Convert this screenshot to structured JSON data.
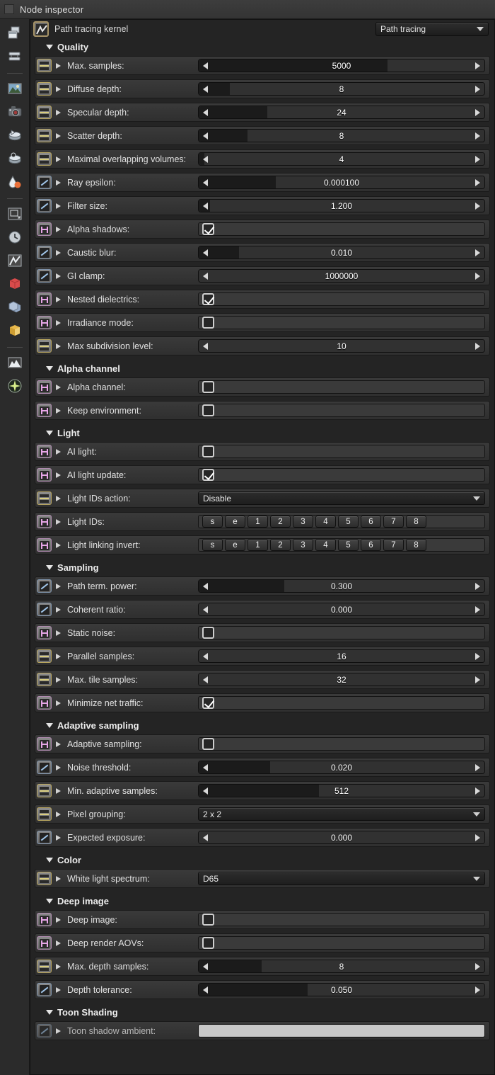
{
  "window": {
    "title": "Node inspector"
  },
  "header": {
    "node_name": "Path tracing kernel",
    "kernel_select": "Path tracing",
    "node_icon": "path-tracing-kernel-icon",
    "caret_icon": "chevron-down-icon"
  },
  "rail": {
    "items": [
      {
        "name": "copy-nodes-icon",
        "glyph": "windows"
      },
      {
        "name": "stack-nodes-icon",
        "glyph": "stack"
      },
      {
        "sep": true
      },
      {
        "name": "image-preview-icon",
        "glyph": "image"
      },
      {
        "name": "camera-icon",
        "glyph": "camera"
      },
      {
        "name": "film-reel-icon",
        "glyph": "reel1"
      },
      {
        "name": "film-reel-alt-icon",
        "glyph": "reel2"
      },
      {
        "name": "color-drop-icon",
        "glyph": "drop"
      },
      {
        "sep": true
      },
      {
        "name": "resolution-icon",
        "glyph": "frame"
      },
      {
        "name": "clock-icon",
        "glyph": "clock"
      },
      {
        "name": "kernel-icon",
        "glyph": "kernel"
      },
      {
        "name": "red-cube-icon",
        "glyph": "cubeRed"
      },
      {
        "name": "blue-layers-icon",
        "glyph": "cubeBlue"
      },
      {
        "name": "orange-geometry-icon",
        "glyph": "cubeOrange"
      },
      {
        "sep": true
      },
      {
        "name": "histogram-icon",
        "glyph": "histogram"
      },
      {
        "name": "light-star-icon",
        "glyph": "star"
      }
    ]
  },
  "sections": [
    {
      "title": "Quality",
      "rows": [
        {
          "type": "slider",
          "icon": "int",
          "label": "Max. samples:",
          "value": "5000",
          "fill": 66
        },
        {
          "type": "slider",
          "icon": "int",
          "label": "Diffuse depth:",
          "value": "8",
          "fill": 11
        },
        {
          "type": "slider",
          "icon": "int",
          "label": "Specular depth:",
          "value": "24",
          "fill": 24
        },
        {
          "type": "slider",
          "icon": "int",
          "label": "Scatter depth:",
          "value": "8",
          "fill": 17
        },
        {
          "type": "slider",
          "icon": "int",
          "label": "Maximal overlapping volumes:",
          "value": "4",
          "fill": 2
        },
        {
          "type": "slider",
          "icon": "flt",
          "label": "Ray epsilon:",
          "value": "0.000100",
          "fill": 27
        },
        {
          "type": "slider",
          "icon": "flt",
          "label": "Filter size:",
          "value": "1.200",
          "fill": 4
        },
        {
          "type": "checkbox",
          "icon": "boo",
          "label": "Alpha shadows:",
          "checked": true
        },
        {
          "type": "slider",
          "icon": "flt",
          "label": "Caustic blur:",
          "value": "0.010",
          "fill": 14
        },
        {
          "type": "slider",
          "icon": "flt",
          "label": "GI clamp:",
          "value": "1000000",
          "fill": 0
        },
        {
          "type": "checkbox",
          "icon": "boo",
          "label": "Nested dielectrics:",
          "checked": true
        },
        {
          "type": "checkbox",
          "icon": "boo",
          "label": "Irradiance mode:",
          "checked": false
        },
        {
          "type": "slider",
          "icon": "int",
          "label": "Max subdivision level:",
          "value": "10",
          "fill": 0
        }
      ]
    },
    {
      "title": "Alpha channel",
      "rows": [
        {
          "type": "checkbox",
          "icon": "boo",
          "label": "Alpha channel:",
          "checked": false
        },
        {
          "type": "checkbox",
          "icon": "boo",
          "label": "Keep environment:",
          "checked": false
        }
      ]
    },
    {
      "title": "Light",
      "rows": [
        {
          "type": "checkbox",
          "icon": "boo",
          "label": "AI light:",
          "checked": false
        },
        {
          "type": "checkbox",
          "icon": "boo",
          "label": "AI light update:",
          "checked": true
        },
        {
          "type": "combo",
          "icon": "int",
          "label": "Light IDs action:",
          "value": "Disable"
        },
        {
          "type": "idstrip",
          "icon": "boo",
          "label": "Light IDs:",
          "buttons": [
            "s",
            "e",
            "1",
            "2",
            "3",
            "4",
            "5",
            "6",
            "7",
            "8"
          ]
        },
        {
          "type": "idstrip",
          "icon": "boo",
          "label": "Light linking invert:",
          "buttons": [
            "s",
            "e",
            "1",
            "2",
            "3",
            "4",
            "5",
            "6",
            "7",
            "8"
          ]
        }
      ]
    },
    {
      "title": "Sampling",
      "rows": [
        {
          "type": "slider",
          "icon": "flt",
          "label": "Path term. power:",
          "value": "0.300",
          "fill": 30
        },
        {
          "type": "slider",
          "icon": "flt",
          "label": "Coherent ratio:",
          "value": "0.000",
          "fill": 0
        },
        {
          "type": "checkbox",
          "icon": "boo",
          "label": "Static noise:",
          "checked": false
        },
        {
          "type": "slider",
          "icon": "int",
          "label": "Parallel samples:",
          "value": "16",
          "fill": 0
        },
        {
          "type": "slider",
          "icon": "int",
          "label": "Max. tile samples:",
          "value": "32",
          "fill": 0
        },
        {
          "type": "checkbox",
          "icon": "boo",
          "label": "Minimize net traffic:",
          "checked": true
        }
      ]
    },
    {
      "title": "Adaptive sampling",
      "rows": [
        {
          "type": "checkbox",
          "icon": "boo",
          "label": "Adaptive sampling:",
          "checked": false
        },
        {
          "type": "slider",
          "icon": "flt",
          "label": "Noise threshold:",
          "value": "0.020",
          "fill": 25
        },
        {
          "type": "slider",
          "icon": "int",
          "label": "Min. adaptive samples:",
          "value": "512",
          "fill": 42
        },
        {
          "type": "combo",
          "icon": "int",
          "label": "Pixel grouping:",
          "value": "2 x 2"
        },
        {
          "type": "slider",
          "icon": "flt",
          "label": "Expected exposure:",
          "value": "0.000",
          "fill": 0
        }
      ]
    },
    {
      "title": "Color",
      "rows": [
        {
          "type": "combo",
          "icon": "int",
          "label": "White light spectrum:",
          "value": "D65"
        }
      ]
    },
    {
      "title": "Deep image",
      "rows": [
        {
          "type": "checkbox",
          "icon": "boo",
          "label": "Deep image:",
          "checked": false
        },
        {
          "type": "checkbox",
          "icon": "boo",
          "label": "Deep render AOVs:",
          "checked": false
        },
        {
          "type": "slider",
          "icon": "int",
          "label": "Max. depth samples:",
          "value": "8",
          "fill": 22
        },
        {
          "type": "slider",
          "icon": "flt",
          "label": "Depth tolerance:",
          "value": "0.050",
          "fill": 38
        }
      ]
    },
    {
      "title": "Toon Shading",
      "rows": [
        {
          "type": "swatch",
          "icon": "flt",
          "dim": true,
          "label": "Toon shadow ambient:",
          "color": "#c8c8c8"
        }
      ]
    }
  ]
}
